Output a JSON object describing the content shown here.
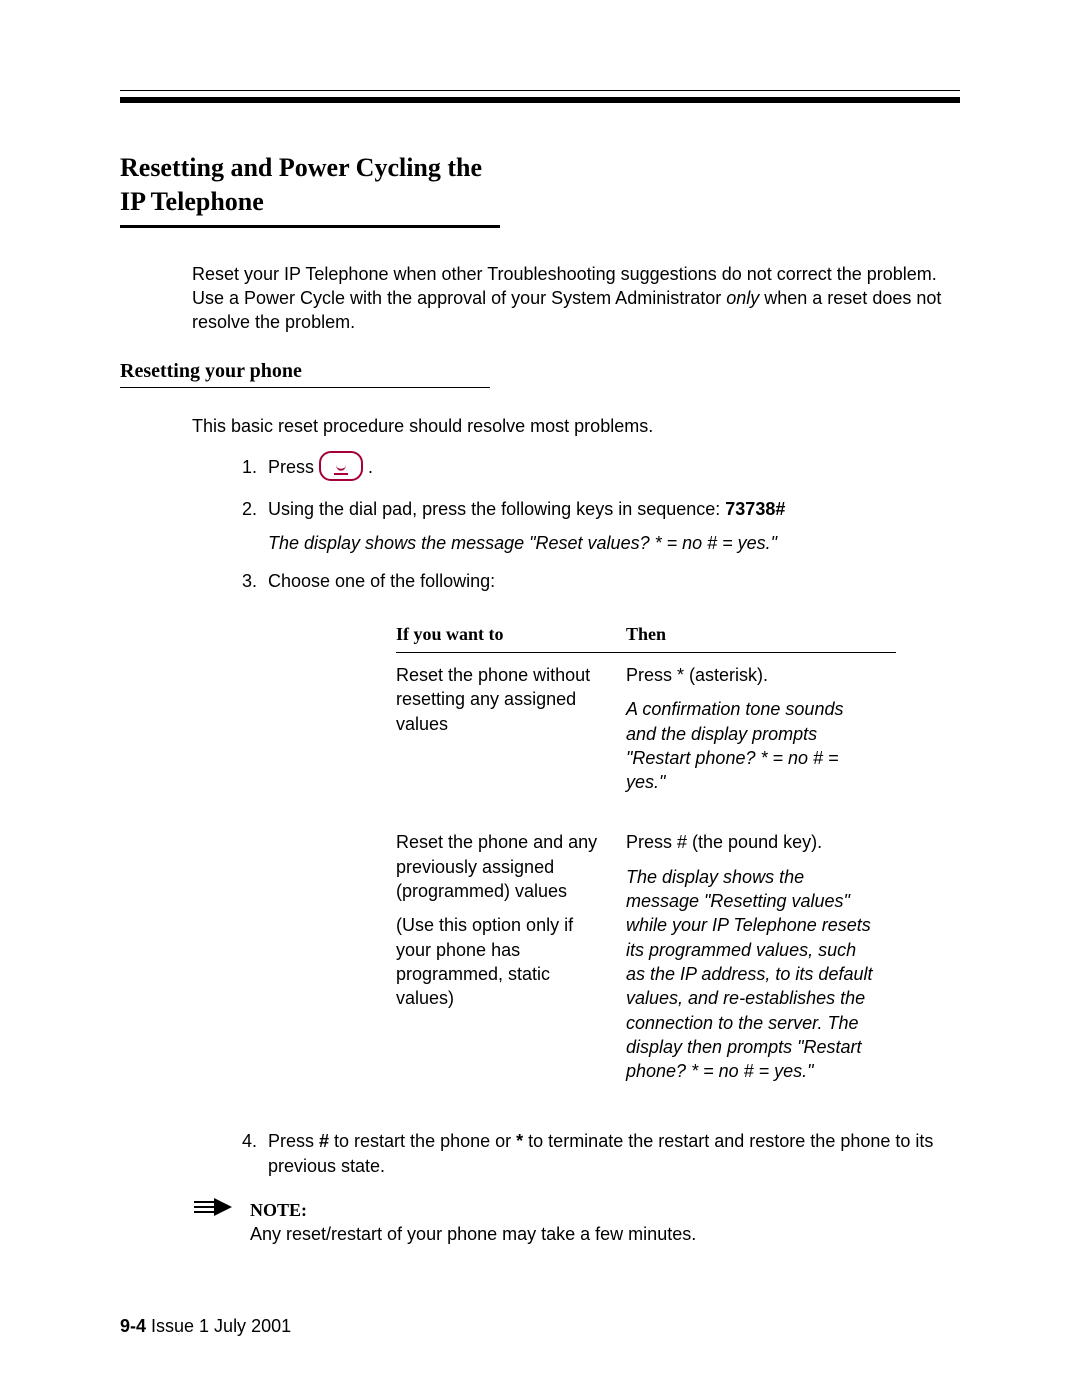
{
  "title": "Resetting and Power Cycling the IP Telephone",
  "intro_plain": "Reset your IP Telephone when other Troubleshooting suggestions do not correct the problem. Use a Power Cycle with the approval of your System Administrator ",
  "intro_italic_word": "only",
  "intro_tail": " when a reset does not resolve the problem.",
  "sub_heading": "Resetting your phone",
  "sub_intro": "This basic reset procedure should resolve most problems.",
  "steps": {
    "s1_prefix": "Press ",
    "s1_suffix": ".",
    "s2_text": "Using the dial pad, press the following keys in sequence: ",
    "s2_sequence": "73738#",
    "s2_display_msg": "The display shows the message \"Reset values? * = no # = yes.\"",
    "s3_text": "Choose one of the following:",
    "s4_text_a": "Press ",
    "s4_bold1": "#",
    "s4_text_b": " to restart the phone or ",
    "s4_bold2": "*",
    "s4_text_c": " to terminate the restart and restore the phone to its previous state."
  },
  "table": {
    "head_if": "If you want to",
    "head_then": "Then",
    "row1": {
      "if": "Reset the phone without resetting any assigned values",
      "then_action": "Press * (asterisk).",
      "then_result": "A confirmation tone sounds and the display prompts \"Restart phone? * = no # = yes.\""
    },
    "row2": {
      "if_a": "Reset the phone and any previously assigned (programmed) values",
      "if_b": "(Use this option only if your phone has programmed, static values)",
      "then_action": "Press # (the pound key).",
      "then_result": "The display shows the message \"Resetting values\" while your IP Telephone resets its programmed values, such as the IP address, to its default values, and re-establishes the connection to the server. The display then prompts \"Restart phone? * = no # = yes.\""
    }
  },
  "note": {
    "label": "NOTE:",
    "body": "Any reset/restart of your phone may take a few minutes."
  },
  "footer": {
    "page_num": "9-4",
    "rest": "  Issue  1   July 2001"
  }
}
